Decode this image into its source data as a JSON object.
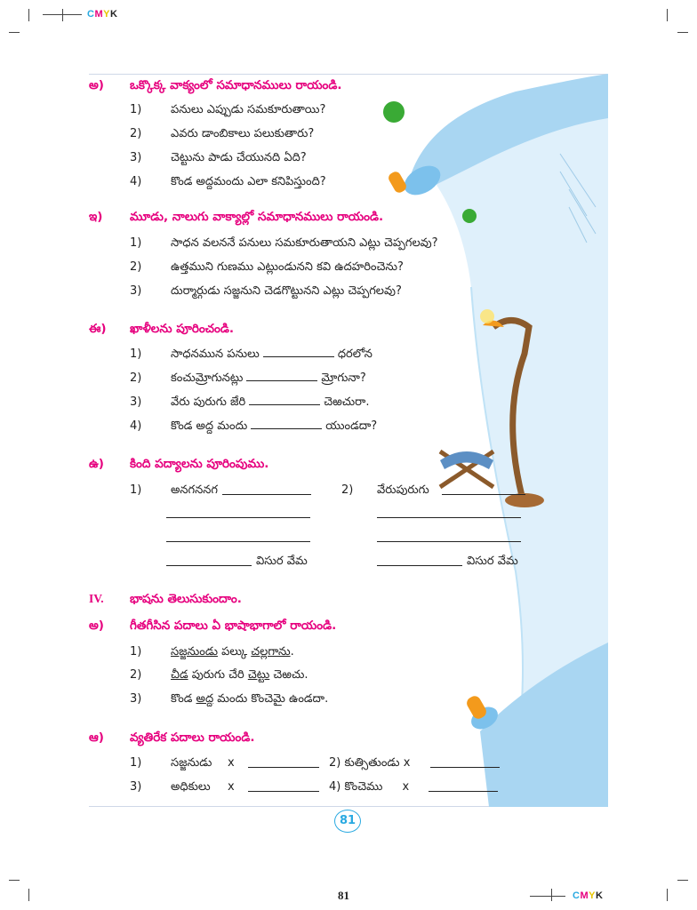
{
  "cmyk_mark": {
    "c": "C",
    "m": "M",
    "y": "Y",
    "k": "K"
  },
  "section_a": {
    "label": "అ)",
    "title": "ఒక్కొక్క వాక్యంలో సమాధానములు రాయండి.",
    "items": [
      {
        "n": "1)",
        "t": "పనులు ఎప్పుడు సమకూరుతాయి?"
      },
      {
        "n": "2)",
        "t": "ఎవరు డాంబికాలు పలుకుతారు?"
      },
      {
        "n": "3)",
        "t": "చెట్టును పాడు చేయునది ఏది?"
      },
      {
        "n": "4)",
        "t": "కొండ అద్దమందు ఎలా కనిపిస్తుంది?"
      }
    ]
  },
  "section_i": {
    "label": "ఇ)",
    "title": "మూడు, నాలుగు వాక్యాల్లో సమాధానములు రాయండి.",
    "items": [
      {
        "n": "1)",
        "t": "సాధన వలననే పనులు సమకూరుతాయని ఎట్లు చెప్పగలవు?"
      },
      {
        "n": "2)",
        "t": "ఉత్తముని గుణము ఎట్లుండునని కవి ఉదహరించెను?"
      },
      {
        "n": "3)",
        "t": "దుర్మార్గుడు సజ్జనుని చెడగొట్టునని ఎట్లు చెప్పగలవు?"
      }
    ]
  },
  "section_ii": {
    "label": "ఈ)",
    "title": "ఖాళీలను పూరించండి.",
    "items": [
      {
        "n": "1)",
        "a": "సాధనమున పనులు",
        "b": "ధరలోన"
      },
      {
        "n": "2)",
        "a": "కంచుమ్రోగునట్లు",
        "b": "మ్రోగునా?"
      },
      {
        "n": "3)",
        "a": "వేరు పురుగు జేరి",
        "b": "చెఱచురా."
      },
      {
        "n": "4)",
        "a": "కొండ అద్ద మందు",
        "b": "యుండదా?"
      }
    ]
  },
  "section_u": {
    "label": "ఉ)",
    "title": "కింది పద్యాలను పూరింపుము.",
    "poem1": {
      "n": "1)",
      "start": "అనగననగ",
      "end": "విసుర వేమ"
    },
    "poem2": {
      "n": "2)",
      "start": "వేరుపురుగు",
      "end": "విసుర వేమ"
    }
  },
  "section_iv": {
    "label": "IV.",
    "title": "భాషను తెలుసుకుందాం."
  },
  "section_iv_a": {
    "label": "అ)",
    "title": "గీతగీసిన పదాలు ఏ భాషాభాగాలో రాయండి.",
    "items": [
      {
        "n": "1)",
        "u1": "సజ్జనుండు",
        "m1": " పల్కు ",
        "u2": "చల్లగాను",
        "m2": "."
      },
      {
        "n": "2)",
        "u1": "చీడ",
        "m1": " పురుగు చేరి ",
        "u2": "చెట్టు",
        "m2": " చెఱచు."
      },
      {
        "n": "3)",
        "p1": "కొండ ",
        "u1": "అద్ద",
        "m1": " మందు కొంచెమై ఉండదా."
      }
    ]
  },
  "section_iv_aa": {
    "label": "ఆ)",
    "title": "వ్యతిరేక పదాలు రాయండి.",
    "items": [
      {
        "n": "1)",
        "w": "సజ్జనుడు",
        "x": "x",
        "n2": "2)",
        "w2": "కుత్సితుండు",
        "x2": "x"
      },
      {
        "n": "3)",
        "w": "అధికులు",
        "x": "x",
        "n2": "4)",
        "w2": "కొంచెము",
        "x2": "x"
      }
    ]
  },
  "page_number_circle": "81",
  "page_number_footer": "81",
  "colors": {
    "heading": "#e6007e",
    "scroll": "#a9d6f2",
    "scroll_dark": "#5fb3e6",
    "accent_orange": "#f39a1c",
    "accent_green": "#3aaa35"
  }
}
